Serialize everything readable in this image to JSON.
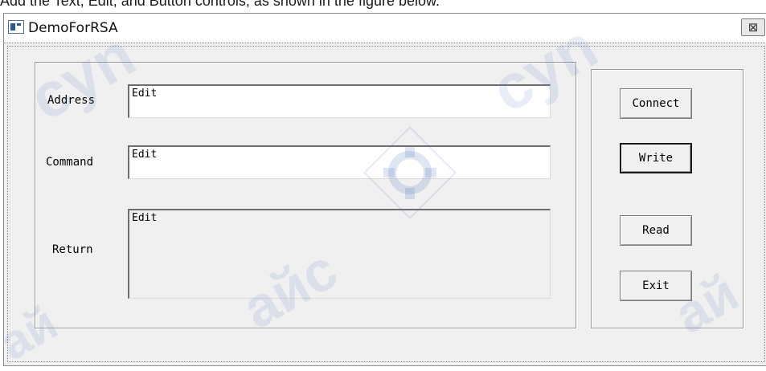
{
  "caption_text": "Add the Text, Edit, and Button controls, as shown in the figure below.",
  "window": {
    "title": "DemoForRSA",
    "close_glyph": "⊠"
  },
  "labels": {
    "address": "Address",
    "command": "Command",
    "return": "Return"
  },
  "fields": {
    "address_value": "Edit",
    "command_value": "Edit",
    "return_value": "Edit"
  },
  "buttons": {
    "connect": "Connect",
    "write": "Write",
    "read": "Read",
    "exit": "Exit"
  },
  "watermark": {
    "text1": "cyn",
    "text2": "cyn",
    "text3": "айс",
    "text4": "ай",
    "text5": "ай"
  }
}
